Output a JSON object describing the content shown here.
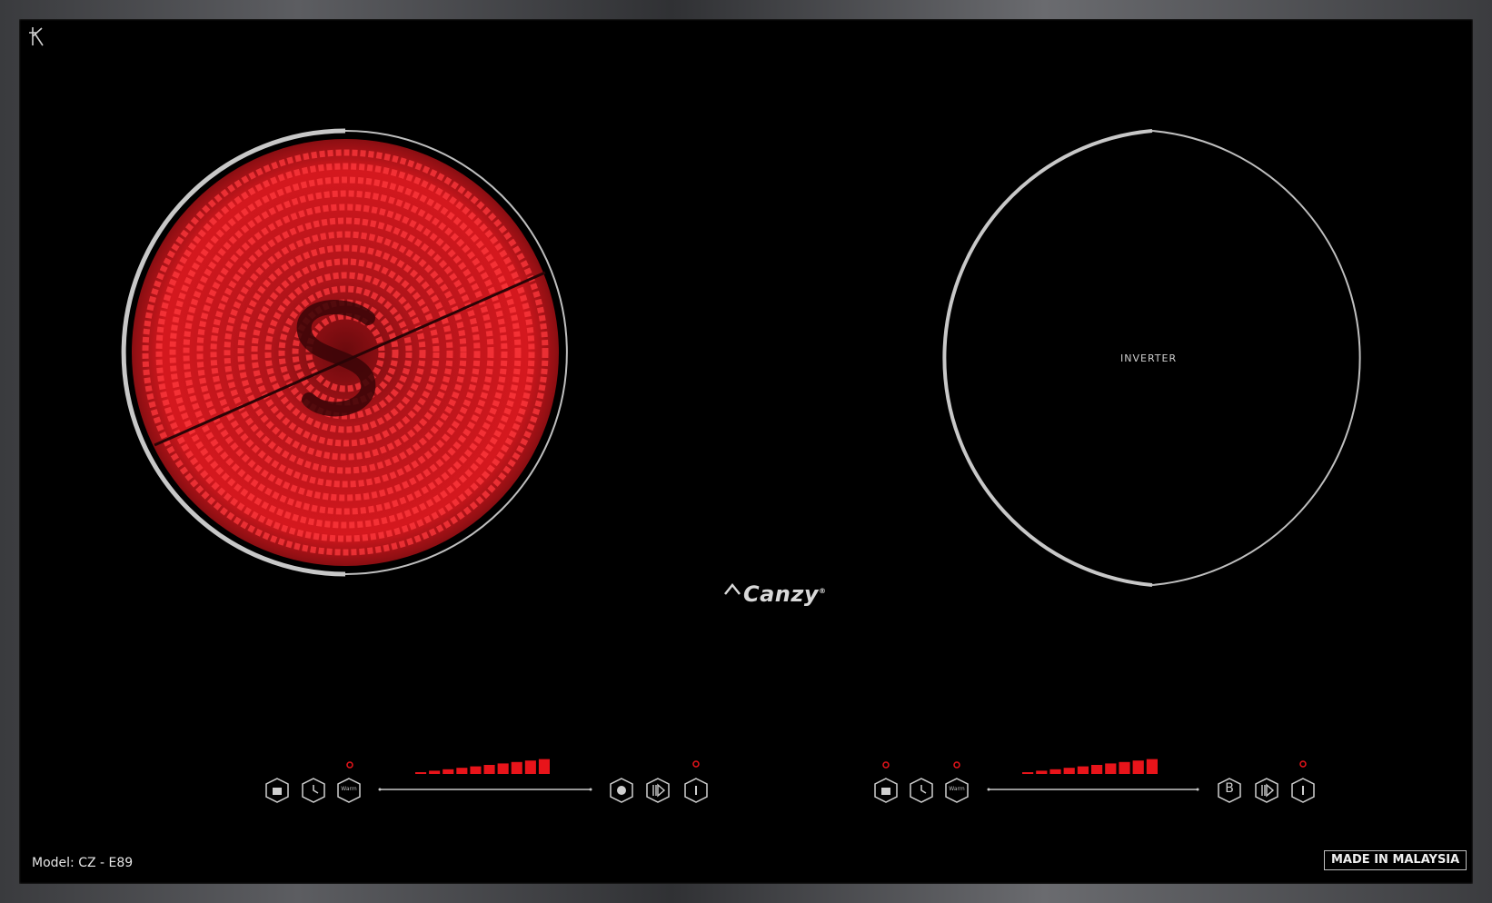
{
  "brand": {
    "name": "Canzy",
    "registered_mark": "®",
    "corner_logo_icon": "hk-monogram-icon"
  },
  "model_label": "Model: CZ - E89",
  "origin_badge": "MADE IN MALAYSIA",
  "zones": {
    "left": {
      "type": "radiant",
      "active": true,
      "glow_color": "#e8141a"
    },
    "right": {
      "type": "induction",
      "label": "INVERTER",
      "active": false
    }
  },
  "controls": {
    "left": {
      "buttons": [
        "lock-icon",
        "timer-icon",
        "warm-button",
        "pause-icon",
        "boost-icon",
        "power-icon"
      ],
      "warm_label": "Warm",
      "power_slider_segments": 10,
      "indicator_color": "#e8141a"
    },
    "right": {
      "buttons": [
        "lock-icon",
        "timer-icon",
        "warm-button",
        "b-button",
        "boost-icon",
        "power-icon"
      ],
      "warm_label": "Warm",
      "b_label": "B",
      "power_slider_segments": 10,
      "indicator_color": "#e8141a"
    }
  },
  "colors": {
    "glass": "#000000",
    "frame": "#4a4b4e",
    "ring": "#bfbfbf",
    "indicator": "#e8141a"
  }
}
